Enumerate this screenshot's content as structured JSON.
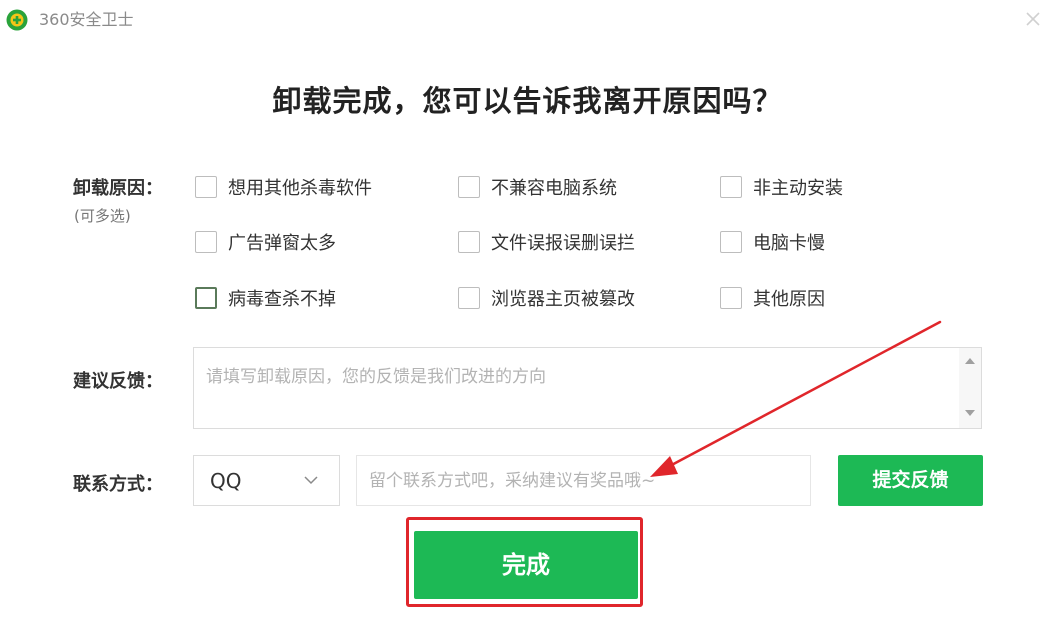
{
  "window": {
    "title": "360安全卫士",
    "logo_icon": "360-logo-icon",
    "close_icon": "close-icon"
  },
  "headline": "卸载完成，您可以告诉我离开原因吗？",
  "reasons": {
    "label": "卸载原因：",
    "sublabel": "(可多选)",
    "options": [
      {
        "label": "想用其他杀毒软件",
        "checked": false
      },
      {
        "label": "不兼容电脑系统",
        "checked": false
      },
      {
        "label": "非主动安装",
        "checked": false
      },
      {
        "label": "广告弹窗太多",
        "checked": false
      },
      {
        "label": "文件误报误删误拦",
        "checked": false
      },
      {
        "label": "电脑卡慢",
        "checked": false
      },
      {
        "label": "病毒查杀不掉",
        "checked": false
      },
      {
        "label": "浏览器主页被篡改",
        "checked": false
      },
      {
        "label": "其他原因",
        "checked": false
      }
    ]
  },
  "feedback": {
    "label": "建议反馈：",
    "placeholder": "请填写卸载原因，您的反馈是我们改进的方向"
  },
  "contact": {
    "label": "联系方式：",
    "method_selected": "QQ",
    "placeholder": "留个联系方式吧，采纳建议有奖品哦~"
  },
  "buttons": {
    "submit": "提交反馈",
    "done": "完成"
  },
  "colors": {
    "primary_green": "#1db955",
    "annotation_red": "#e0262b",
    "logo_green": "#2aa33b",
    "logo_yellow": "#f5c518"
  }
}
